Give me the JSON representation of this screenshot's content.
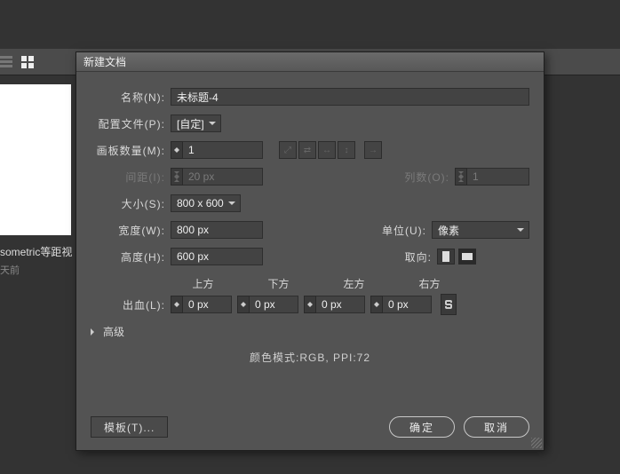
{
  "bg": {
    "thumb_title": "sometric等距视",
    "thumb_sub": "天前"
  },
  "dialog": {
    "title": "新建文档",
    "name_label": "名称(N):",
    "name_value": "未标题-4",
    "profile_label": "配置文件(P):",
    "profile_value": "[自定]",
    "artboards_label": "画板数量(M):",
    "artboards_value": "1",
    "spacing_label": "间距(I):",
    "spacing_value": "20 px",
    "columns_label": "列数(O):",
    "columns_value": "1",
    "size_label": "大小(S):",
    "size_value": "800 x 600",
    "width_label": "宽度(W):",
    "width_value": "800 px",
    "units_label": "单位(U):",
    "units_value": "像素",
    "height_label": "高度(H):",
    "height_value": "600 px",
    "orient_label": "取向:",
    "bleed_label": "出血(L):",
    "bleed_top": "上方",
    "bleed_bottom": "下方",
    "bleed_left": "左方",
    "bleed_right": "右方",
    "bleed_val": "0 px",
    "advanced": "高级",
    "color_mode": "颜色模式:RGB, PPI:72",
    "template_btn": "模板(T)...",
    "ok": "确定",
    "cancel": "取消",
    "link_glyph": "⬚",
    "arrange_icons": [
      "⤢",
      "⇄",
      "↔",
      "↕",
      "→"
    ]
  }
}
